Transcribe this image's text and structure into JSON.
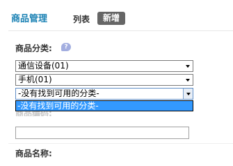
{
  "header": {
    "title": "商品管理",
    "tabs": [
      {
        "label": "列表"
      },
      {
        "label": "新增"
      }
    ]
  },
  "form": {
    "category": {
      "label": "商品分类:",
      "help_icon": "?",
      "level1_value": "通信设备(01)",
      "level2_value": "手机(01)",
      "level3_value": "-没有找到可用的分类-",
      "level3_options": [
        "-没有找到可用的分类-"
      ]
    },
    "code": {
      "label": "商品编码:",
      "value": ""
    },
    "name": {
      "label": "商品名称:"
    }
  },
  "colors": {
    "title": "#1b82b4",
    "tab_active_bg": "#666666",
    "option_highlight": "#3399ff"
  }
}
